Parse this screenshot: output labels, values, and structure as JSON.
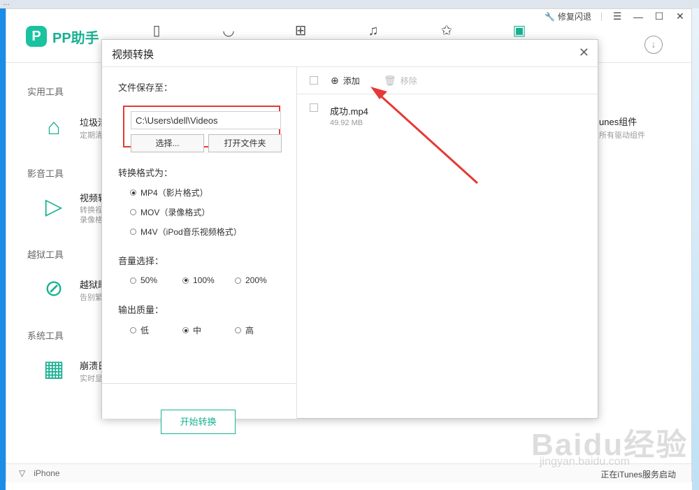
{
  "app": {
    "name": "PP助手",
    "repair_label": "修复闪退",
    "window_controls": [
      "☰",
      "—",
      "☐",
      "✕"
    ],
    "brand_color": "#19b091",
    "nav_icons": [
      "phone-icon",
      "app-store-icon",
      "game-icon",
      "music-icon",
      "star-icon",
      "toolbox-icon"
    ]
  },
  "left_panel": {
    "sections": [
      {
        "title": "实用工具",
        "tool_name": "垃圾清",
        "tool_desc": "定期清"
      },
      {
        "title": "影音工具",
        "tool_name": "视频转",
        "tool_desc": "转换视",
        "tool_desc2": "录像格"
      },
      {
        "title": "越狱工具",
        "tool_name": "越狱助",
        "tool_desc": "告别繁"
      },
      {
        "title": "系统工具",
        "tool_name": "崩溃日",
        "tool_desc": "实时显"
      }
    ]
  },
  "right_panel": {
    "tool_name": "unes组件",
    "tool_desc": "所有驱动组件"
  },
  "status_bar": {
    "device": "iPhone",
    "right_text": "正在iTunes服务启动"
  },
  "watermark": {
    "main": "Baidu经验",
    "sub": "jingyan.baidu.com"
  },
  "dialog": {
    "title": "视频转换",
    "save_to_label": "文件保存至：",
    "path_value": "C:\\Users\\dell\\Videos",
    "choose_btn": "选择...",
    "open_folder_btn": "打开文件夹",
    "format_label": "转换格式为：",
    "formats": [
      {
        "label": "MP4（影片格式）",
        "selected": true
      },
      {
        "label": "MOV（录像格式）",
        "selected": false
      },
      {
        "label": "M4V（iPod音乐视频格式）",
        "selected": false
      }
    ],
    "volume_label": "音量选择：",
    "volumes": [
      {
        "label": "50%",
        "selected": false
      },
      {
        "label": "100%",
        "selected": true
      },
      {
        "label": "200%",
        "selected": false
      }
    ],
    "quality_label": "输出质量：",
    "qualities": [
      {
        "label": "低",
        "selected": false
      },
      {
        "label": "中",
        "selected": true
      },
      {
        "label": "高",
        "selected": false
      }
    ],
    "start_btn": "开始转换",
    "add_btn": "添加",
    "remove_btn": "移除",
    "file": {
      "name": "成功.mp4",
      "size": "49.92 MB"
    }
  }
}
